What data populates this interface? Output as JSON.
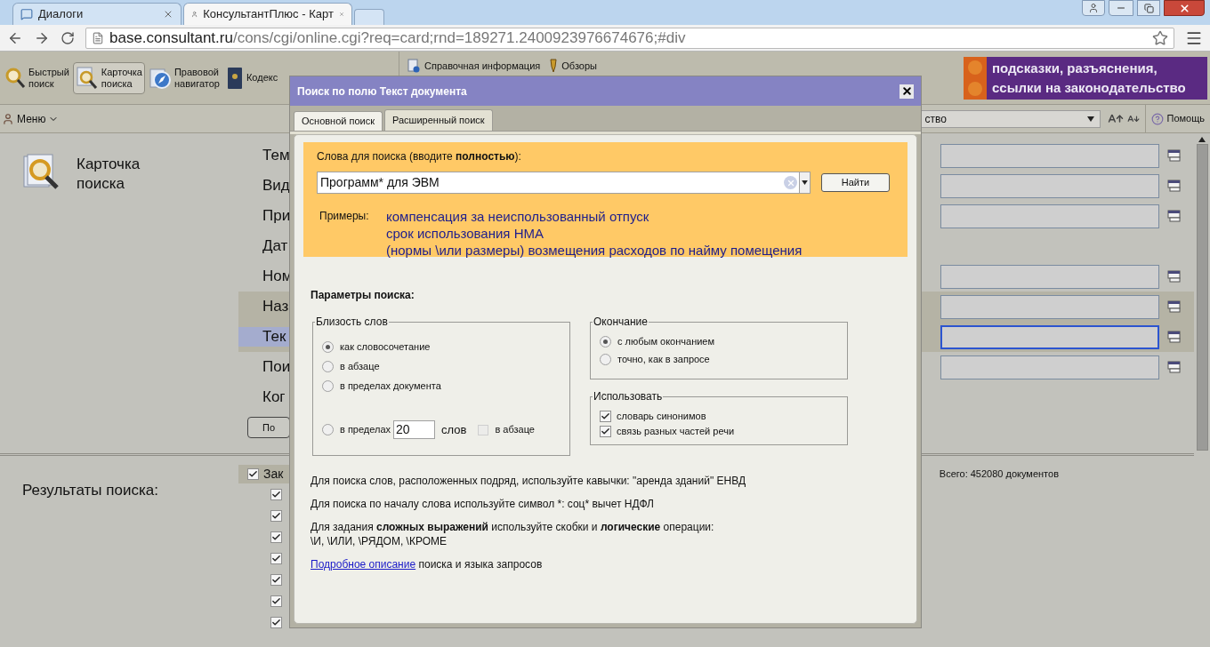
{
  "browser": {
    "tabs": [
      {
        "title": "Диалоги",
        "selected": false
      },
      {
        "title": "КонсультантПлюс - Карт",
        "selected": true
      }
    ],
    "url_host": "base.consultant.ru",
    "url_path": "/cons/cgi/online.cgi?req=card;rnd=189271.2400923976674676;#div"
  },
  "toolbar": {
    "tools": [
      {
        "lines": [
          "Быстрый",
          "поиск"
        ],
        "kind": "magnifier",
        "selected": false
      },
      {
        "lines": [
          "Карточка",
          "поиска"
        ],
        "kind": "card",
        "selected": true
      },
      {
        "lines": [
          "Правовой",
          "навигатор"
        ],
        "kind": "compass",
        "selected": false
      },
      {
        "lines": [
          "Кодекс"
        ],
        "kind": "book",
        "selected": false
      }
    ],
    "links": [
      {
        "label": "Справочная информация",
        "kind": "info"
      },
      {
        "label": "Обзоры",
        "kind": "pen"
      }
    ],
    "banner": [
      "подсказки, разъяснения,",
      "ссылки на законодательство"
    ]
  },
  "menubar": {
    "menu": "Меню",
    "source": "ство",
    "help": "Помощь"
  },
  "card": {
    "title_lines": [
      "Карточка",
      "поиска"
    ],
    "fields": [
      {
        "label": "Тем",
        "kind": "input",
        "grouped": false,
        "selected": false
      },
      {
        "label": "Вид",
        "kind": "input",
        "grouped": false,
        "selected": false
      },
      {
        "label": "При",
        "kind": "input",
        "grouped": false,
        "selected": false
      },
      {
        "label": "Дат",
        "kind": "plain",
        "grouped": false,
        "selected": false
      },
      {
        "label": "Ном",
        "kind": "input",
        "grouped": false,
        "selected": false
      },
      {
        "label": "Наз",
        "kind": "input",
        "grouped": true,
        "selected": false
      },
      {
        "label": "Тек",
        "kind": "input",
        "grouped": true,
        "selected": true
      },
      {
        "label": "Пои",
        "kind": "input",
        "grouped": false,
        "selected": false
      },
      {
        "label": "Ког",
        "kind": "plain",
        "grouped": false,
        "selected": false
      }
    ],
    "button": "По"
  },
  "results": {
    "title": "Результаты поиска:",
    "total": "Всего: 452080 документов",
    "group": {
      "label": "Зак",
      "checked": true
    },
    "items": [
      {
        "checked": true
      },
      {
        "checked": true
      },
      {
        "checked": true
      },
      {
        "checked": true
      },
      {
        "checked": true
      },
      {
        "checked": true
      },
      {
        "checked": true
      }
    ]
  },
  "dialog": {
    "title": "Поиск по полю Текст документа",
    "tabs": [
      {
        "label": "Основной поиск",
        "selected": false
      },
      {
        "label": "Расширенный поиск",
        "selected": true
      }
    ],
    "query_label": "Слова для поиска (вводите **полностью**):",
    "query": "Программ* для ЭВМ",
    "find_button": "Найти",
    "examples_label": "Примеры:",
    "examples": [
      "компенсация за неиспользованный отпуск",
      "срок использования НМА",
      "(нормы \\или размеры) возмещения расходов по найму помещения"
    ],
    "params_title": "Параметры поиска:",
    "proximity": {
      "legend": "Близость слов",
      "options": [
        {
          "label": "как словосочетание",
          "selected": true,
          "kind": "plain"
        },
        {
          "label": "в абзаце",
          "selected": false,
          "kind": "plain"
        },
        {
          "label": "в пределах документа",
          "selected": false,
          "kind": "plain"
        },
        {
          "label": "в пределах",
          "selected": false,
          "kind": "within"
        }
      ],
      "within_value": "20",
      "within_unit": "слов",
      "within_paragraph": {
        "label": "в абзаце",
        "checked": false
      }
    },
    "ending": {
      "legend": "Окончание",
      "options": [
        {
          "label": "с любым окончанием",
          "selected": true
        },
        {
          "label": "точно, как в запросе",
          "selected": false
        }
      ]
    },
    "use": {
      "legend": "Использовать",
      "options": [
        {
          "label": "словарь синонимов",
          "checked": true
        },
        {
          "label": "связь разных частей речи",
          "checked": true
        }
      ]
    },
    "hints": [
      {
        "kind": "plain",
        "text": "Для поиска слов, расположенных подряд, используйте кавычки: \"аренда зданий\" ЕНВД"
      },
      {
        "kind": "plain",
        "text": "Для поиска по началу слова используйте символ *: соц* вычет НДФЛ"
      },
      {
        "kind": "marked",
        "text": "Для задания **сложных выражений** используйте скобки и **логические** операции:\n\\И, \\ИЛИ, \\РЯДОМ, \\КРОМЕ"
      }
    ],
    "link": "Подробное описание",
    "link_rest": "поиска и языка запросов"
  }
}
